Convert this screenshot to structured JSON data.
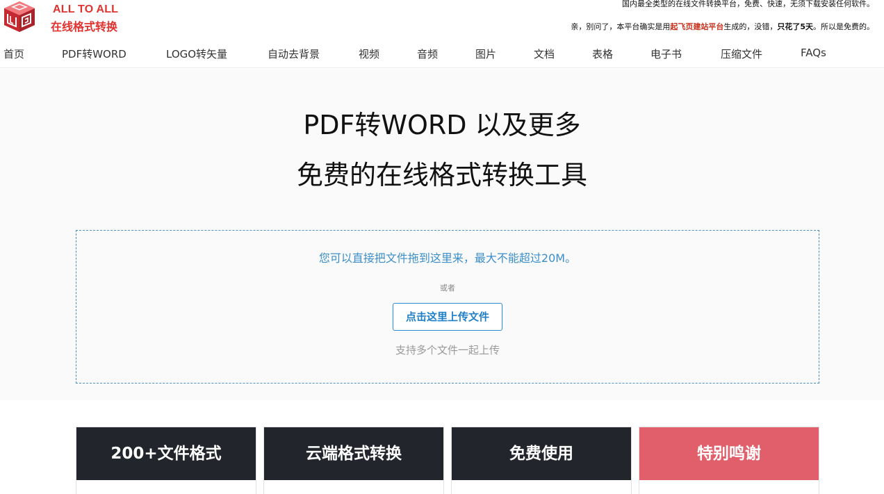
{
  "header": {
    "brand_line1": "ALL TO ALL",
    "brand_line2": "在线格式转换",
    "tagline": "国内最全类型的在线文件转换平台，免费、快速，无须下载安装任何软件。",
    "note_prefix": "亲，别问了，本平台确实是用",
    "note_highlight": "起飞页建站平台",
    "note_middle": "生成的，没错，",
    "note_bold": "只花了5天",
    "note_suffix": "。所以是免费的。"
  },
  "nav": {
    "items": [
      {
        "label": "首页"
      },
      {
        "label": "PDF转WORD"
      },
      {
        "label": "LOGO转矢量"
      },
      {
        "label": "自动去背景"
      },
      {
        "label": "视频"
      },
      {
        "label": "音频"
      },
      {
        "label": "图片"
      },
      {
        "label": "文档"
      },
      {
        "label": "表格"
      },
      {
        "label": "电子书"
      },
      {
        "label": "压缩文件"
      },
      {
        "label": "FAQs"
      }
    ]
  },
  "hero": {
    "title_line1": "PDF转WORD 以及更多",
    "title_line2": "免费的在线格式转换工具"
  },
  "upload": {
    "drag_text": "您可以直接把文件拖到这里来，最大不能超过20M。",
    "or_text": "或者",
    "button_label": "点击这里上传文件",
    "multi_text": "支持多个文件一起上传"
  },
  "features": {
    "items": [
      {
        "title": "200+文件格式"
      },
      {
        "title": "云端格式转换"
      },
      {
        "title": "免费使用"
      },
      {
        "title": "特别鸣谢"
      }
    ]
  },
  "colors": {
    "brand_red": "#e0322f",
    "link_blue": "#3b8ec9",
    "dark_card": "#22252b",
    "pink_card": "#e05f6b"
  }
}
